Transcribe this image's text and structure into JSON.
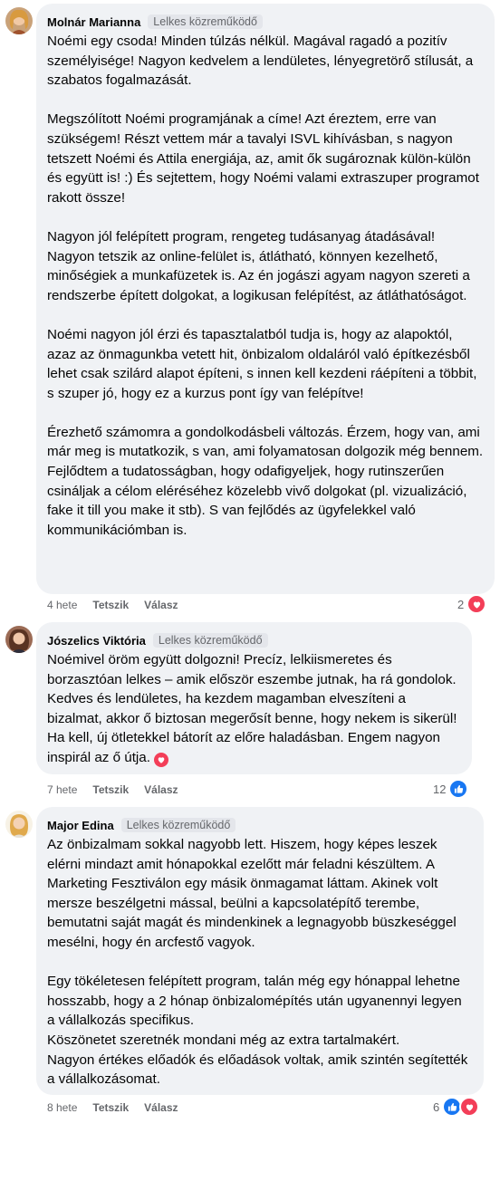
{
  "colors": {
    "bubble": "#f0f2f5",
    "heart": "#f33e58",
    "like": "#1877f2",
    "meta": "#65676b"
  },
  "comments": [
    {
      "author": "Molnár Marianna",
      "badge": "Lelkes közreműködő",
      "paragraphs": [
        "Noémi egy csoda! Minden túlzás nélkül. Magával ragadó a pozitív személyisége! Nagyon kedvelem a lendületes, lényegretörő stílusát, a szabatos fogalmazását.",
        "Megszólított Noémi programjának a címe! Azt éreztem, erre van szükségem! Részt vettem már a tavalyi ISVL kihívásban, s nagyon tetszett Noémi és Attila energiája, az, amit ők sugároznak külön-külön és együtt is! :) És sejtettem, hogy Noémi valami extraszuper programot rakott össze!",
        "Nagyon jól felépített program, rengeteg tudásanyag átadásával! Nagyon tetszik az online-felület is, átlátható, könnyen kezelhető, minőségiek a munkafüzetek is. Az én jogászi agyam nagyon szereti a rendszerbe épített dolgokat, a logikusan felépítést, az átláthatóságot.",
        "Noémi nagyon jól érzi és tapasztalatból tudja is, hogy az alapoktól, azaz az önmagunkba vetett hit, önbizalom oldaláról való építkezésből lehet csak szilárd alapot építeni, s innen kell kezdeni ráépíteni a többit, s szuper jó, hogy ez a kurzus pont így van felépítve!",
        "Érezhető számomra a gondolkodásbeli változás. Érzem, hogy van, ami már meg is mutatkozik, s van, ami folyamatosan dolgozik még bennem. Fejlődtem a tudatosságban, hogy odafigyeljek, hogy rutinszerűen csináljak a célom eléréséhez közelebb vivő dolgokat (pl. vizualizáció, fake it till you make it stb). S van fejlődés az ügyfelekkel való kommunikációmban is."
      ],
      "time": "4 hete",
      "like_label": "Tetszik",
      "reply_label": "Válasz",
      "reaction_count": "2",
      "reactions": [
        "heart"
      ]
    },
    {
      "author": "Jószelics Viktória",
      "badge": "Lelkes közreműködő",
      "paragraphs": [
        "Noémivel öröm együtt dolgozni! Precíz, lelkiismeretes és borzasztóan lelkes – amik először eszembe jutnak, ha rá gondolok. Kedves és lendületes, ha kezdem magamban elveszíteni a bizalmat, akkor ő biztosan megerősít benne, hogy nekem is sikerül! Ha kell, új ötletekkel bátorít az előre haladásban. Engem nagyon inspirál az ő útja."
      ],
      "time": "7 hete",
      "like_label": "Tetszik",
      "reply_label": "Válasz",
      "reaction_count": "12",
      "reactions": [
        "like"
      ]
    },
    {
      "author": "Major Edina",
      "badge": "Lelkes közreműködő",
      "paragraphs": [
        "Az önbizalmam sokkal nagyobb lett. Hiszem, hogy képes leszek elérni mindazt amit hónapokkal ezelőtt már feladni készültem. A Marketing Fesztiválon egy másik önmagamat láttam. Akinek volt mersze beszélgetni mással, beülni a kapcsolatépítő terembe, bemutatni saját magát és mindenkinek a legnagyobb büszkeséggel mesélni, hogy én arcfestő vagyok.",
        "Egy tökéletesen felépített program, talán még egy hónappal lehetne hosszabb, hogy a 2 hónap önbizalomépítés után ugyanennyi legyen a vállalkozás specifikus.",
        "Köszönetet szeretnék mondani még az extra tartalmakért.",
        "Nagyon értékes előadók és előadások voltak, amik szintén segítették a vállalkozásomat."
      ],
      "time": "8 hete",
      "like_label": "Tetszik",
      "reply_label": "Válasz",
      "reaction_count": "6",
      "reactions": [
        "like",
        "heart"
      ]
    }
  ]
}
